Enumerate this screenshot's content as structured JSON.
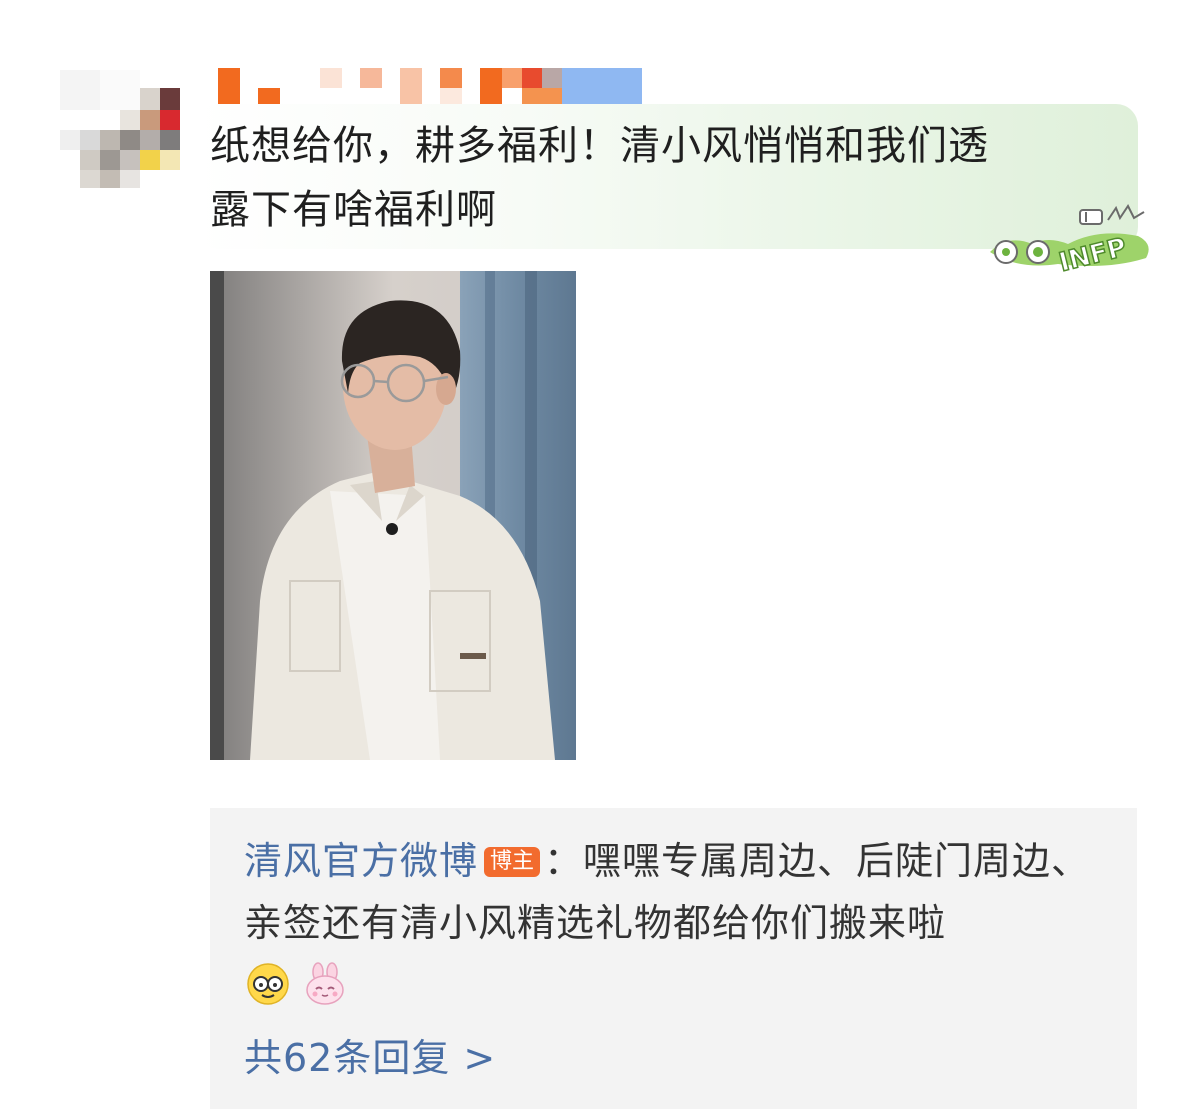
{
  "comment": {
    "author_name": "",
    "text_line1": "纸想给你，耕多福利！清小风悄悄和我们透",
    "text_line2": "露下有啥福利啊",
    "badge_text": "INFP"
  },
  "reply": {
    "author": "清风官方微博",
    "author_tag": "博主",
    "text": "：嘿嘿专属周边、后陡门周边、亲签还有清小风精选礼物都给你们搬来啦",
    "emojis": [
      "glasses-face-emoji",
      "pink-bunny-emoji"
    ],
    "reply_count_label": "共62条回复 >"
  },
  "colors": {
    "link_blue": "#4a6fa5",
    "tag_orange": "#f26b2e",
    "reply_bg": "#f3f3f3",
    "bubble_green": "#dff0da"
  }
}
